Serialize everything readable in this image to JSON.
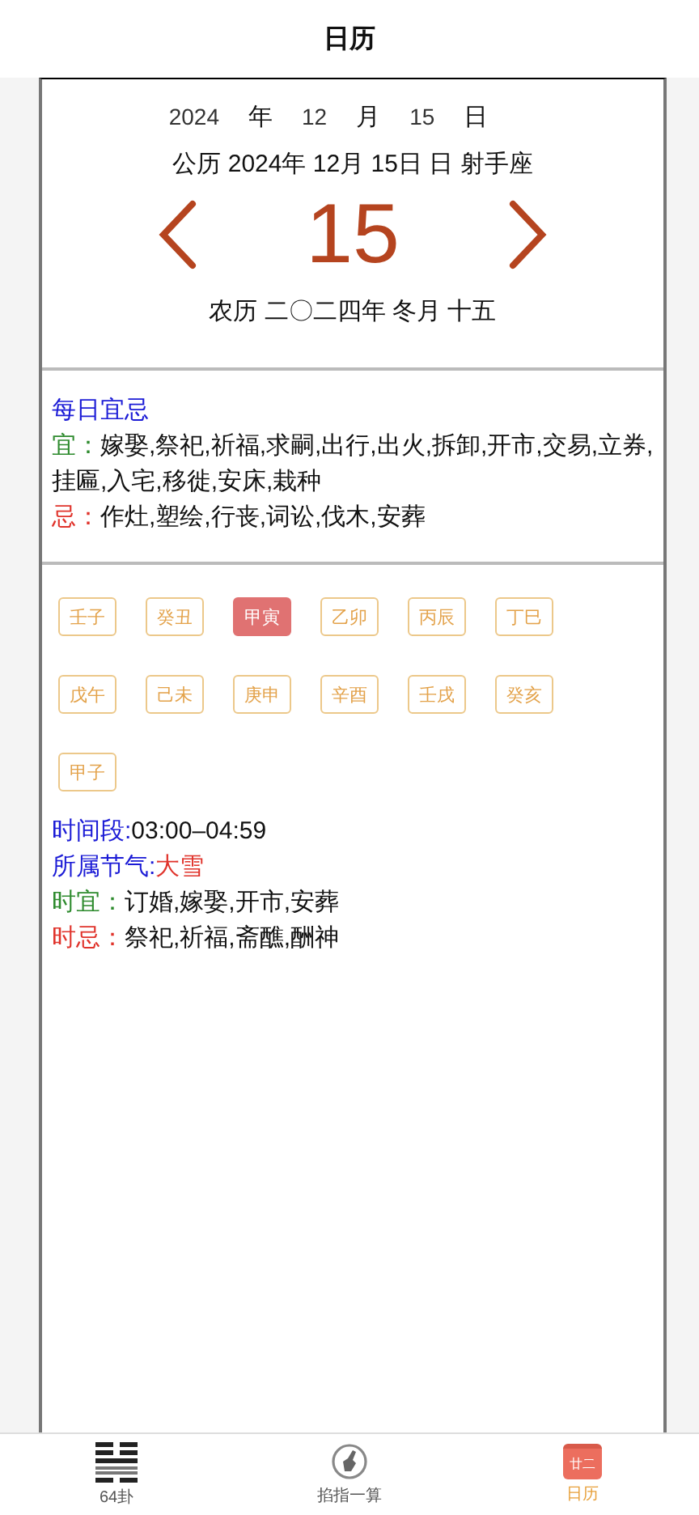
{
  "header": {
    "title": "日历"
  },
  "date_picker": [
    {
      "value": "2024",
      "unit": "年"
    },
    {
      "value": "12",
      "unit": "月"
    },
    {
      "value": "15",
      "unit": "日"
    }
  ],
  "solar_line": "公历 2024年 12月 15日 日 射手座",
  "day": {
    "number": "15"
  },
  "lunar_line": "农历 二〇二四年 冬月 十五",
  "daily": {
    "title": "每日宜忌",
    "yi_label": "宜：",
    "yi_text": "嫁娶,祭祀,祈福,求嗣,出行,出火,拆卸,开市,交易,立券,挂匾,入宅,移徙,安床,栽种",
    "ji_label": "忌：",
    "ji_text": "作灶,塑绘,行丧,词讼,伐木,安葬"
  },
  "hours": [
    {
      "label": "壬子",
      "selected": false
    },
    {
      "label": "癸丑",
      "selected": false
    },
    {
      "label": "甲寅",
      "selected": true
    },
    {
      "label": "乙卯",
      "selected": false
    },
    {
      "label": "丙辰",
      "selected": false
    },
    {
      "label": "丁巳",
      "selected": false
    },
    {
      "label": "戊午",
      "selected": false
    },
    {
      "label": "己未",
      "selected": false
    },
    {
      "label": "庚申",
      "selected": false
    },
    {
      "label": "辛酉",
      "selected": false
    },
    {
      "label": "壬戌",
      "selected": false
    },
    {
      "label": "癸亥",
      "selected": false
    },
    {
      "label": "甲子",
      "selected": false
    }
  ],
  "hour_info": {
    "period_label": "时间段:",
    "period": "03:00–04:59",
    "term_label": "所属节气:",
    "term": "大雪",
    "yi_label": "时宜：",
    "yi_text": "订婚,嫁娶,开市,安葬",
    "ji_label": "时忌：",
    "ji_text": "祭祀,祈福,斋醮,酬神"
  },
  "tabbar": [
    {
      "kind": "hexagram",
      "label": "64卦",
      "selected": false
    },
    {
      "kind": "hand",
      "label": "掐指一算",
      "selected": false
    },
    {
      "kind": "calendar",
      "label": "日历",
      "icon_text": "廿二",
      "selected": true
    }
  ]
}
